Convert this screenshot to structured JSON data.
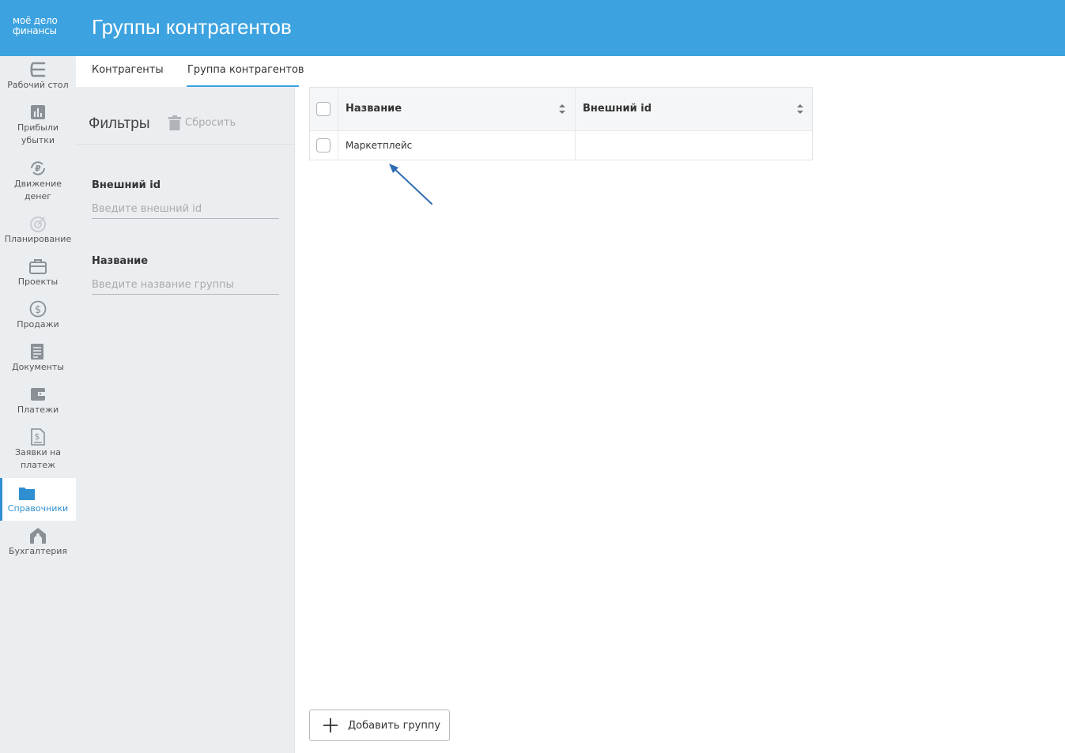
{
  "header": {
    "logo_line1": "моё дело",
    "logo_line2": "финансы",
    "title": "Группы контрагентов",
    "bg_color": "#3da3e0"
  },
  "nav": {
    "items": [
      {
        "label": "Рабочий стол",
        "icon": "desktop-icon"
      },
      {
        "label": "Прибыли убытки",
        "icon": "bar-chart-icon"
      },
      {
        "label": "Движение денег",
        "icon": "ruble-cycle-icon"
      },
      {
        "label": "Планирование",
        "icon": "target-icon"
      },
      {
        "label": "Проекты",
        "icon": "briefcase-icon"
      },
      {
        "label": "Продажи",
        "icon": "dollar-icon"
      },
      {
        "label": "Документы",
        "icon": "document-list-icon"
      },
      {
        "label": "Платежи",
        "icon": "wallet-icon"
      },
      {
        "label": "Заявки на платеж",
        "icon": "payment-request-icon"
      },
      {
        "label": "Справочники",
        "icon": "folder-icon",
        "active": true
      },
      {
        "label": "Бухгалтерия",
        "icon": "house-icon"
      }
    ],
    "active_color": "#2f8fd0"
  },
  "tabs": [
    {
      "label": "Контрагенты"
    },
    {
      "label": "Группа контрагентов",
      "active": true
    }
  ],
  "filters": {
    "title": "Фильтры",
    "reset_label": "Сбросить",
    "external_id": {
      "label": "Внешний id",
      "placeholder": "Введите внешний id",
      "value": ""
    },
    "name": {
      "label": "Название",
      "placeholder": "Введите название группы",
      "value": ""
    }
  },
  "table": {
    "columns": [
      "Название",
      "Внешний id"
    ],
    "rows": [
      {
        "name": "Маркетплейс",
        "external_id": ""
      }
    ]
  },
  "add_button": {
    "label": "Добавить группу"
  },
  "annotation_color": "#2e6db4"
}
